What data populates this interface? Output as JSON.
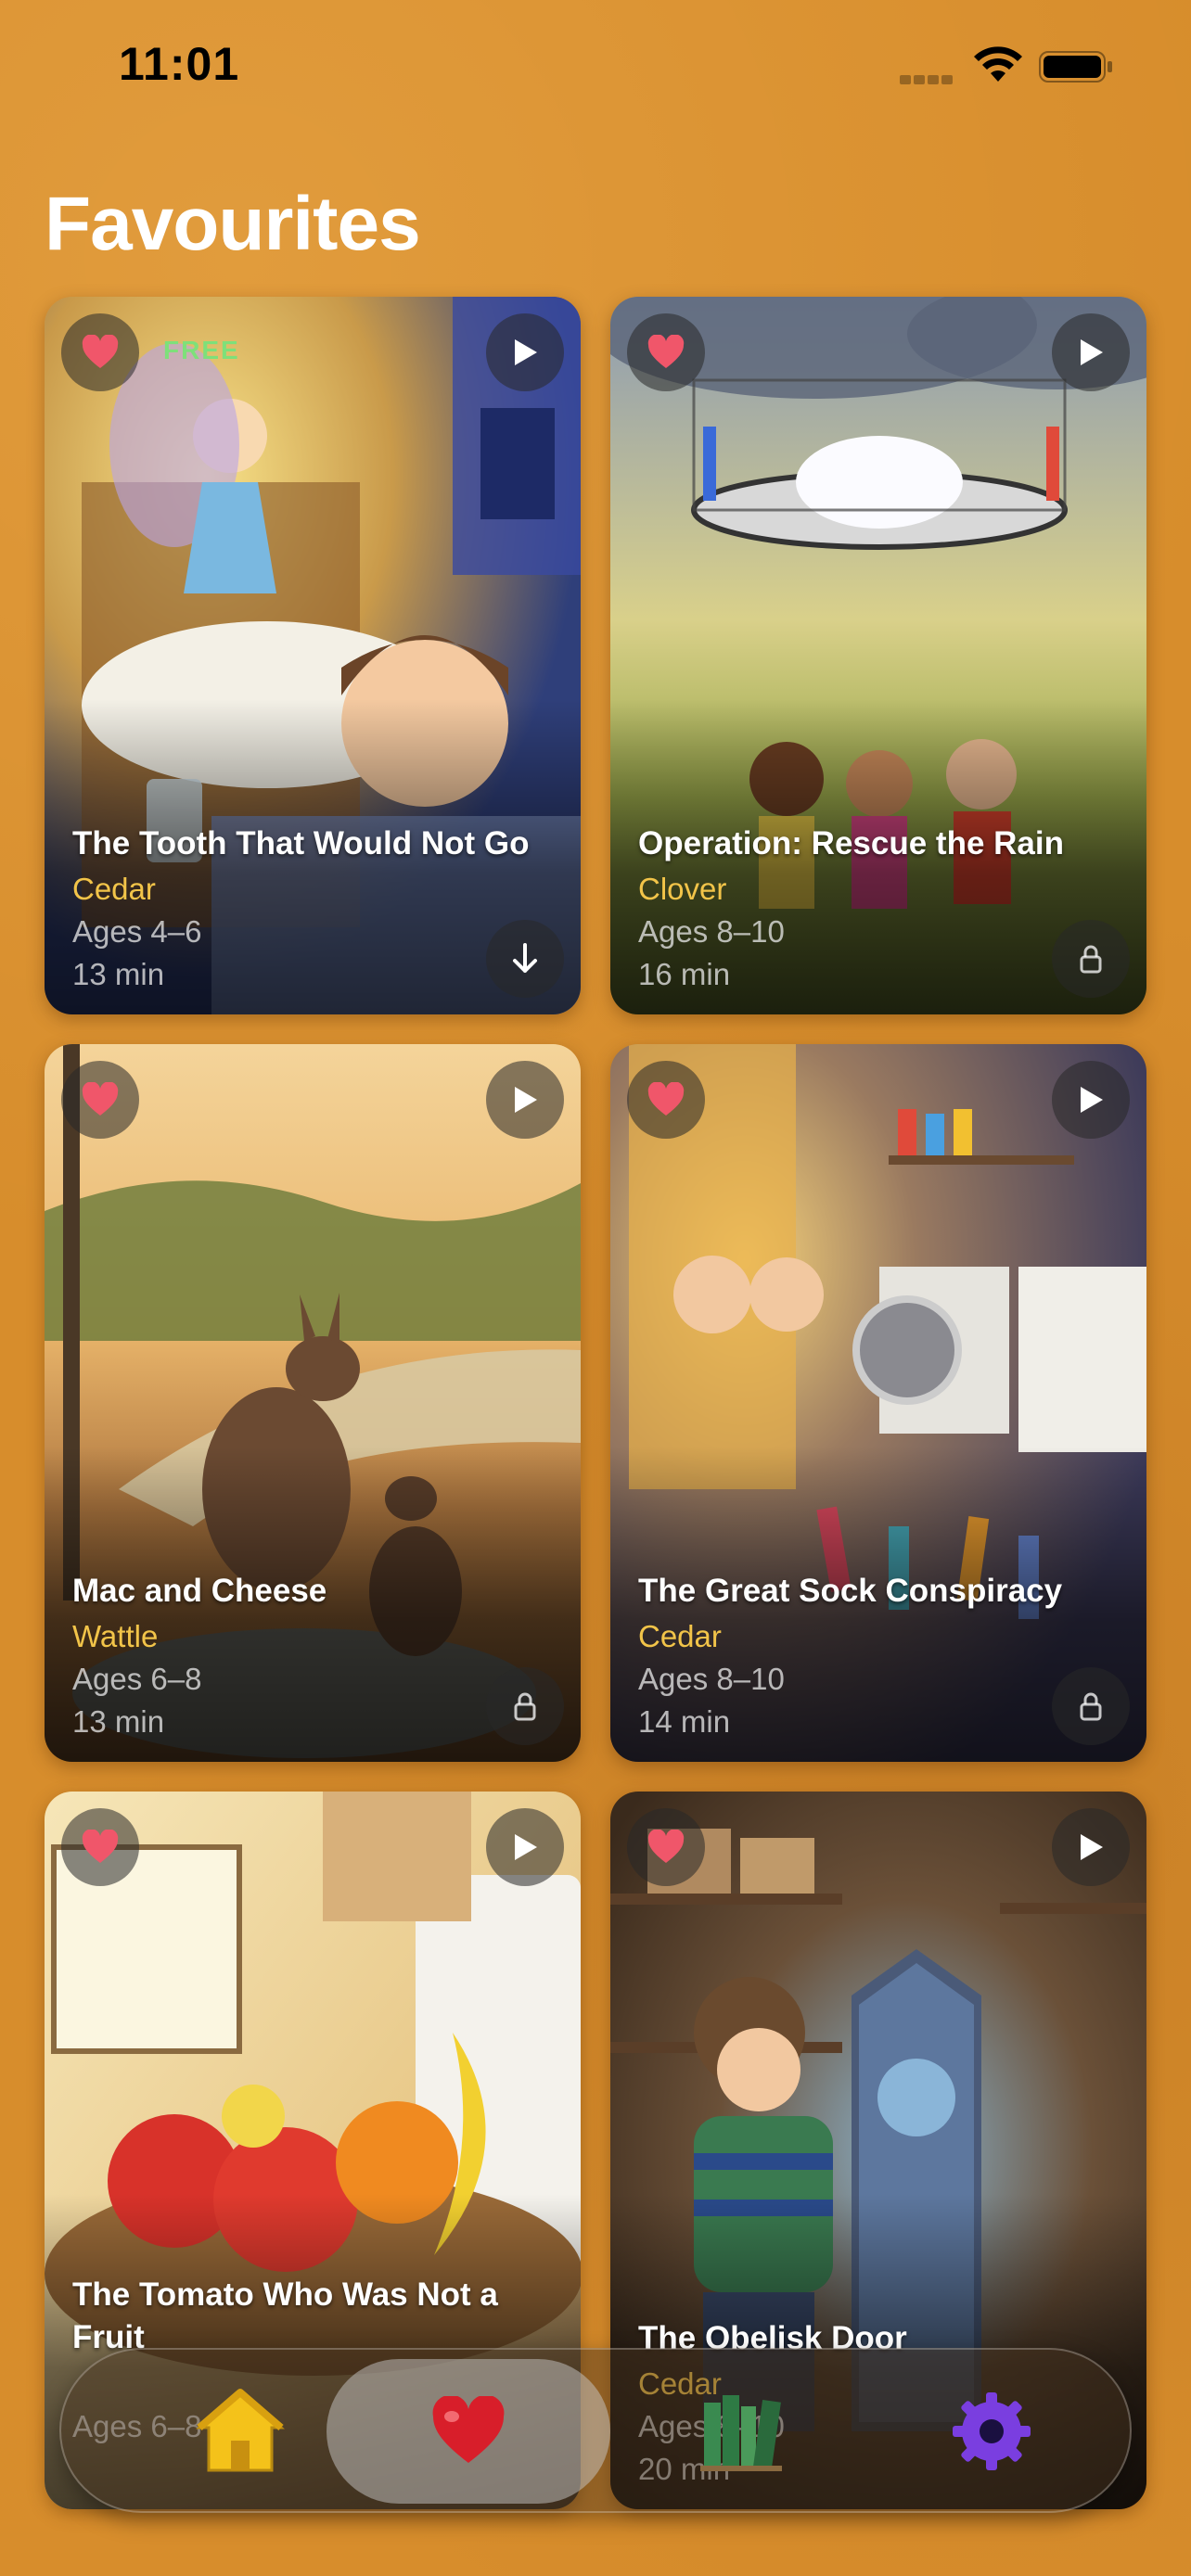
{
  "status_bar": {
    "time": "11:01"
  },
  "page": {
    "title": "Favourites"
  },
  "stories": [
    {
      "title": "The Tooth That Would Not Go",
      "series": "Cedar",
      "ages": "Ages 4–6",
      "duration": "13 min",
      "badge": "FREE",
      "corner_icon": "download-icon",
      "favourited": true
    },
    {
      "title": "Operation: Rescue the Rain",
      "series": "Clover",
      "ages": "Ages 8–10",
      "duration": "16 min",
      "corner_icon": "lock-icon",
      "favourited": true
    },
    {
      "title": "Mac and Cheese",
      "series": "Wattle",
      "ages": "Ages 6–8",
      "duration": "13 min",
      "corner_icon": "lock-icon",
      "favourited": true
    },
    {
      "title": "The Great Sock Conspiracy",
      "series": "Cedar",
      "ages": "Ages 8–10",
      "duration": "14 min",
      "corner_icon": "lock-icon",
      "favourited": true
    },
    {
      "title": "The Tomato Who Was Not a Fruit",
      "series": "",
      "ages": "Ages 6–8",
      "duration": "",
      "favourited": true
    },
    {
      "title": "The Obelisk Door",
      "series": "Cedar",
      "ages": "Ages 8–10",
      "duration": "20 min",
      "favourited": true
    }
  ],
  "tab_bar": {
    "tabs": [
      {
        "name": "home",
        "icon": "house-icon",
        "active": false
      },
      {
        "name": "favourites",
        "icon": "heart-icon",
        "active": true
      },
      {
        "name": "library",
        "icon": "books-icon",
        "active": false
      },
      {
        "name": "settings",
        "icon": "gear-icon",
        "active": false
      }
    ]
  },
  "colors": {
    "background": "#d78d2c",
    "series_text": "#f2c449",
    "heart": "#f0566a",
    "free_badge": "#7ee07a"
  }
}
